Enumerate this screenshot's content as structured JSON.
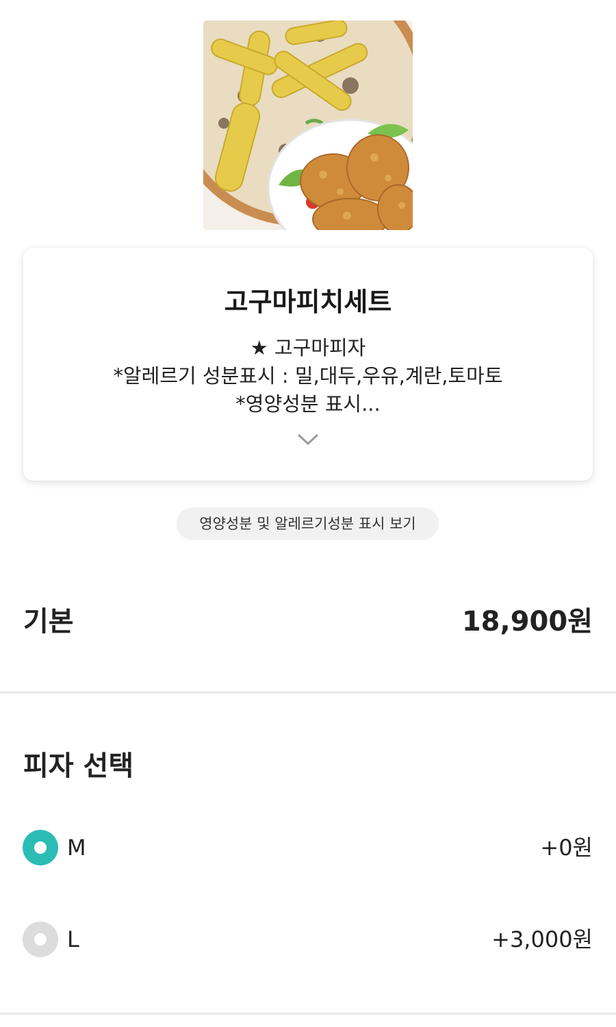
{
  "product": {
    "image_alt": "pizza-and-chicken-set-image",
    "name": "고구마피치세트",
    "description_lines": [
      "★ 고구마피자",
      "*알레르기 성분표시 : 밀,대두,우유,계란,토마토",
      "*영양성분 표시..."
    ]
  },
  "nutrition_button": {
    "label": "영양성분 및 알레르기성분 표시 보기"
  },
  "base": {
    "label": "기본",
    "price": "18,900원"
  },
  "pizza_select": {
    "title": "피자 선택",
    "options": [
      {
        "label": "M",
        "price": "+0원",
        "selected": true
      },
      {
        "label": "L",
        "price": "+3,000원",
        "selected": false
      }
    ]
  },
  "colors": {
    "accent": "#2bbdb5",
    "radio_unselected": "#dcdcdc",
    "pill_bg": "#f1f1f1",
    "divider": "#e8e8e8"
  }
}
